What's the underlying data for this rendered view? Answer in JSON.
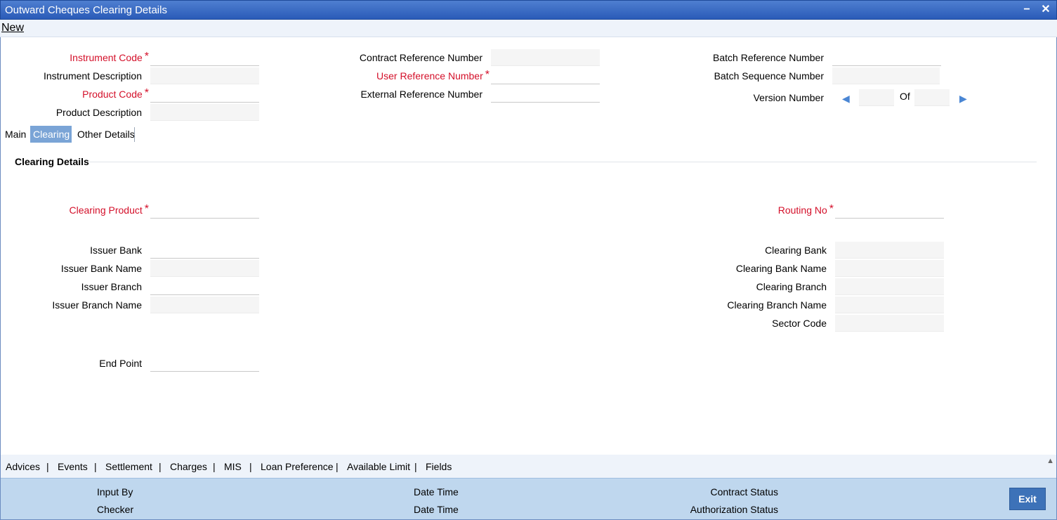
{
  "window": {
    "title": "Outward Cheques Clearing Details",
    "minimize": "−",
    "close": "✕"
  },
  "menu": {
    "new_label": "New"
  },
  "header": {
    "instrument_code": {
      "label": "Instrument Code",
      "value": ""
    },
    "instrument_description": {
      "label": "Instrument Description",
      "value": ""
    },
    "product_code": {
      "label": "Product Code",
      "value": ""
    },
    "product_description": {
      "label": "Product Description",
      "value": ""
    },
    "contract_reference_number": {
      "label": "Contract Reference Number",
      "value": ""
    },
    "user_reference_number": {
      "label": "User Reference Number",
      "value": ""
    },
    "external_reference_number": {
      "label": "External Reference Number",
      "value": ""
    },
    "batch_reference_number": {
      "label": "Batch Reference Number",
      "value": ""
    },
    "batch_sequence_number": {
      "label": "Batch Sequence Number",
      "value": ""
    },
    "version_number": {
      "label": "Version Number",
      "current": "",
      "of_label": "Of",
      "total": ""
    },
    "required_marker": "*"
  },
  "tabs": [
    {
      "label": "Main",
      "active": false
    },
    {
      "label": "Clearing",
      "active": true
    },
    {
      "label": "Other Details",
      "active": false
    }
  ],
  "clearing": {
    "section_title": "Clearing Details",
    "clearing_product": {
      "label": "Clearing Product",
      "value": ""
    },
    "routing_no": {
      "label": "Routing No",
      "value": ""
    },
    "issuer_bank": {
      "label": "Issuer Bank",
      "value": ""
    },
    "issuer_bank_name": {
      "label": "Issuer Bank Name",
      "value": ""
    },
    "issuer_branch": {
      "label": "Issuer Branch",
      "value": ""
    },
    "issuer_branch_name": {
      "label": "Issuer Branch Name",
      "value": ""
    },
    "clearing_bank": {
      "label": "Clearing Bank",
      "value": ""
    },
    "clearing_bank_name": {
      "label": "Clearing Bank Name",
      "value": ""
    },
    "clearing_branch": {
      "label": "Clearing Branch",
      "value": ""
    },
    "clearing_branch_name": {
      "label": "Clearing Branch Name",
      "value": ""
    },
    "sector_code": {
      "label": "Sector Code",
      "value": ""
    },
    "end_point": {
      "label": "End Point",
      "value": ""
    }
  },
  "bottom_links": [
    "Advices",
    "Events",
    "Settlement",
    "Charges",
    "MIS",
    "Loan Preference",
    "Available Limit",
    "Fields"
  ],
  "bottom_separator": "|",
  "footer": {
    "input_by": "Input By",
    "checker": "Checker",
    "date_time_1": "Date Time",
    "date_time_2": "Date Time",
    "contract_status": "Contract Status",
    "authorization_status": "Authorization Status",
    "exit_label": "Exit"
  },
  "icons": {
    "prev": "prev-arrow-icon",
    "next": "next-arrow-icon",
    "scroll": "scroll-up-icon"
  },
  "colors": {
    "titlebar": "#2a5bb8",
    "required": "#d4102a",
    "active_tab": "#7aa4d6",
    "footer": "#bfd7ee",
    "exit_button": "#3d72b8"
  }
}
